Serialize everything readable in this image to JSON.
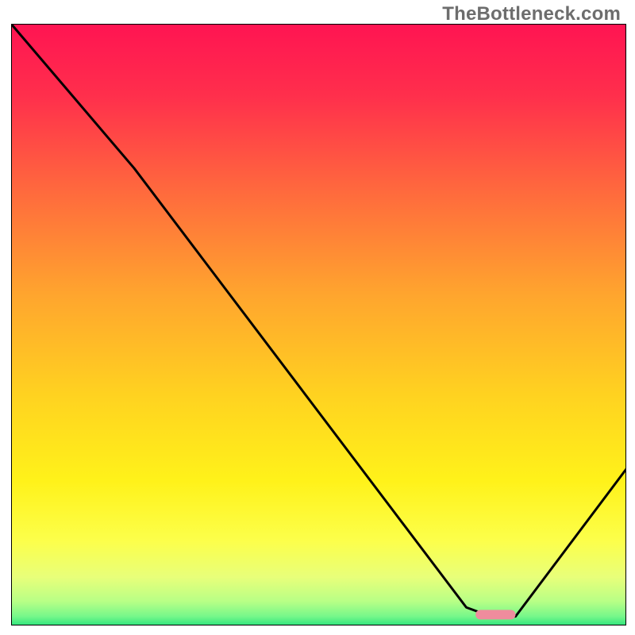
{
  "watermark": "TheBottleneck.com",
  "chart_data": {
    "type": "line",
    "title": "",
    "xlabel": "",
    "ylabel": "",
    "xlim": [
      0,
      100
    ],
    "ylim": [
      0,
      100
    ],
    "grid": false,
    "legend": false,
    "series": [
      {
        "name": "bottleneck-curve",
        "x": [
          0,
          20,
          74,
          78,
          82,
          100
        ],
        "y": [
          100,
          76,
          3,
          1.5,
          1.5,
          26
        ]
      }
    ],
    "highlight_segment": {
      "name": "optimal-range",
      "x_start": 75.5,
      "x_end": 82,
      "y": 1.8,
      "color": "#ef8c9d"
    },
    "gradient_stops": [
      {
        "offset": 0.0,
        "color": "#ff1452"
      },
      {
        "offset": 0.12,
        "color": "#ff2f4c"
      },
      {
        "offset": 0.28,
        "color": "#ff6a3d"
      },
      {
        "offset": 0.45,
        "color": "#ffa52e"
      },
      {
        "offset": 0.62,
        "color": "#ffd320"
      },
      {
        "offset": 0.76,
        "color": "#fff21a"
      },
      {
        "offset": 0.86,
        "color": "#fcff4b"
      },
      {
        "offset": 0.92,
        "color": "#e8ff7a"
      },
      {
        "offset": 0.96,
        "color": "#b8ff86"
      },
      {
        "offset": 0.985,
        "color": "#76f78a"
      },
      {
        "offset": 1.0,
        "color": "#2fe57d"
      }
    ],
    "frame_color": "#000000",
    "curve_color": "#000000"
  }
}
